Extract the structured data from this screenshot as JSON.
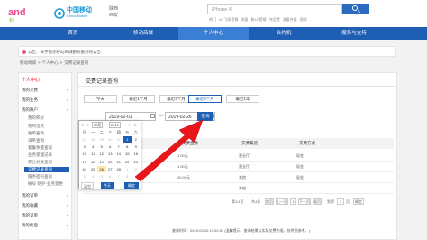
{
  "header": {
    "region_line1": "陕西",
    "region_line2": "西安",
    "cm_cn": "中国移动",
    "cm_en": "China Mobile",
    "search_placeholder": "iPhone X",
    "hot_links": [
      "热门",
      "4G飞享套餐",
      "流量",
      "和4G套餐",
      "充话费",
      "流量充值",
      "视频",
      "..."
    ]
  },
  "nav": {
    "items": [
      "首页",
      "移动商城",
      "个人中心",
      "合约机",
      "服务与支持"
    ],
    "active_index": 2
  },
  "notice": {
    "text": "公告：关于暂停移动商城部分服务的公告"
  },
  "breadcrumb": [
    "移动商城",
    ">",
    "个人中心",
    ">",
    "交费记录查询"
  ],
  "sidebar": {
    "head": "个人中心",
    "items": [
      {
        "label": "我的交费",
        "type": "group"
      },
      {
        "label": "我的业务",
        "type": "group"
      },
      {
        "label": "我的账户",
        "type": "group"
      },
      {
        "label": "我的积分",
        "type": "sub"
      },
      {
        "label": "我的话费",
        "type": "sub"
      },
      {
        "label": "账单查询",
        "type": "sub"
      },
      {
        "label": "详单查询",
        "type": "sub"
      },
      {
        "label": "套餐余量查询",
        "type": "sub"
      },
      {
        "label": "业务受理记录",
        "type": "sub"
      },
      {
        "label": "积分兑换查询",
        "type": "sub"
      },
      {
        "label": "交费记录查询",
        "type": "sub-active"
      },
      {
        "label": "服务密码查询",
        "type": "sub"
      },
      {
        "label": "帐号·防护·业务变更",
        "type": "sub"
      },
      {
        "label": "我的订单",
        "type": "group"
      },
      {
        "label": "我的收藏",
        "type": "group"
      },
      {
        "label": "我的订单",
        "type": "group"
      },
      {
        "label": "我的售后",
        "type": "group"
      }
    ]
  },
  "main": {
    "title": "交费记录查询",
    "time_buttons": [
      "今天",
      "最近1个月",
      "最近3个月",
      "最近6个月",
      "最近1年"
    ],
    "active_time_button": 3,
    "start_date": "2019-02-01",
    "date_separator": "—",
    "end_date": "2019-02-26",
    "query_label": "查询",
    "columns": [
      "交费时间",
      "交费金额",
      "交费渠道",
      "交费方式"
    ],
    "rows": [
      {
        "time": "",
        "amount": "1.00元",
        "channel": "营业厅",
        "method": "现金"
      },
      {
        "time": "",
        "amount": "1.00元",
        "channel": "营业厅",
        "method": "现金"
      },
      {
        "time": "",
        "amount": "40.00元",
        "channel": "其他",
        "method": "现金"
      },
      {
        "time": "2019-02-12 17:25:22",
        "amount": "",
        "channel": "其他",
        "method": ""
      }
    ],
    "pager": {
      "total": "第1/1页",
      "per_page": "共4条",
      "first": "首页",
      "prev": "上一页",
      "page": "1",
      "next": "下一页",
      "last": "尾页",
      "jump_to": "到第",
      "jump_value": "1",
      "jump_unit": "页",
      "go": "确定"
    },
    "bottom_note": "查询时间：2019-02-26 10:52:53 (温馨提示：查询结果以实际交费为准，仅供您参考。)"
  },
  "calendar": {
    "month_label": "二月",
    "year_label": "2019",
    "weekdays": [
      "日",
      "一",
      "二",
      "三",
      "四",
      "五",
      "六"
    ],
    "weeks": [
      [
        {
          "d": "27",
          "o": true
        },
        {
          "d": "28",
          "o": true
        },
        {
          "d": "29",
          "o": true
        },
        {
          "d": "30",
          "o": true
        },
        {
          "d": "31",
          "o": true
        },
        {
          "d": "1",
          "sel": true
        },
        {
          "d": "2"
        }
      ],
      [
        {
          "d": "3"
        },
        {
          "d": "4"
        },
        {
          "d": "5"
        },
        {
          "d": "6"
        },
        {
          "d": "7"
        },
        {
          "d": "8"
        },
        {
          "d": "9"
        }
      ],
      [
        {
          "d": "10"
        },
        {
          "d": "11"
        },
        {
          "d": "12"
        },
        {
          "d": "13"
        },
        {
          "d": "14"
        },
        {
          "d": "15"
        },
        {
          "d": "16"
        }
      ],
      [
        {
          "d": "17"
        },
        {
          "d": "18"
        },
        {
          "d": "19"
        },
        {
          "d": "20"
        },
        {
          "d": "21"
        },
        {
          "d": "22"
        },
        {
          "d": "23"
        }
      ],
      [
        {
          "d": "24"
        },
        {
          "d": "25"
        },
        {
          "d": "26",
          "hl": true
        },
        {
          "d": "27"
        },
        {
          "d": "28"
        },
        {
          "d": "1",
          "o": true
        },
        {
          "d": "2",
          "o": true
        }
      ],
      [
        {
          "d": "3",
          "o": true
        },
        {
          "d": "4",
          "o": true
        },
        {
          "d": "5",
          "o": true
        },
        {
          "d": "6",
          "o": true
        },
        {
          "d": "7",
          "o": true
        },
        {
          "d": "8",
          "o": true
        },
        {
          "d": "9",
          "o": true
        }
      ]
    ],
    "footer": [
      "清空",
      "今天",
      "确定"
    ]
  },
  "colors": {
    "nav_blue": "#1e5fb4",
    "brand_red": "#e60012",
    "arrow_red": "#e8151b"
  }
}
